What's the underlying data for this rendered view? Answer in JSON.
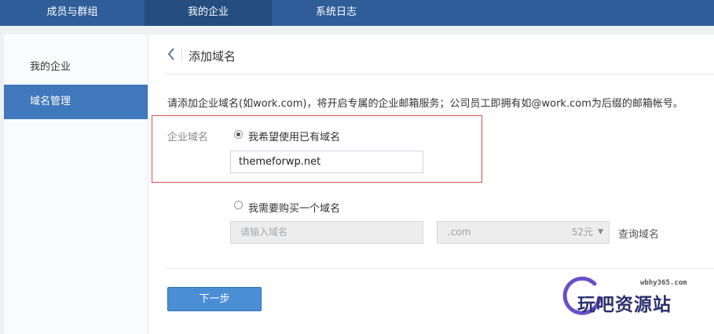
{
  "topnav": {
    "tabs": [
      {
        "label": "成员与群组"
      },
      {
        "label": "我的企业"
      },
      {
        "label": "系统日志"
      }
    ]
  },
  "sidebar": {
    "items": [
      {
        "label": "我的企业"
      },
      {
        "label": "域名管理"
      }
    ]
  },
  "main": {
    "title": "添加域名",
    "description": "请添加企业域名(如work.com)，将开启专属的企业邮箱服务；公司员工即拥有如@work.com为后缀的邮箱帐号。",
    "domain_label": "企业域名",
    "option_own": {
      "label": "我希望使用已有域名",
      "value": "themeforwp.net",
      "checked": true
    },
    "option_buy": {
      "label": "我需要购买一个域名",
      "placeholder": "请输入域名",
      "suffix": ".com",
      "price": "52元",
      "query_label": "查询域名",
      "checked": false
    },
    "next_label": "下一步"
  },
  "watermark": {
    "url": "wbhy365.com",
    "text": "玩吧资源站"
  },
  "colors": {
    "topnav": "#2e5d99",
    "topnav_active": "#244d80",
    "sidebar_active": "#3f78bb",
    "highlight_border": "#d9534f",
    "primary_button": "#4a8fd6"
  }
}
